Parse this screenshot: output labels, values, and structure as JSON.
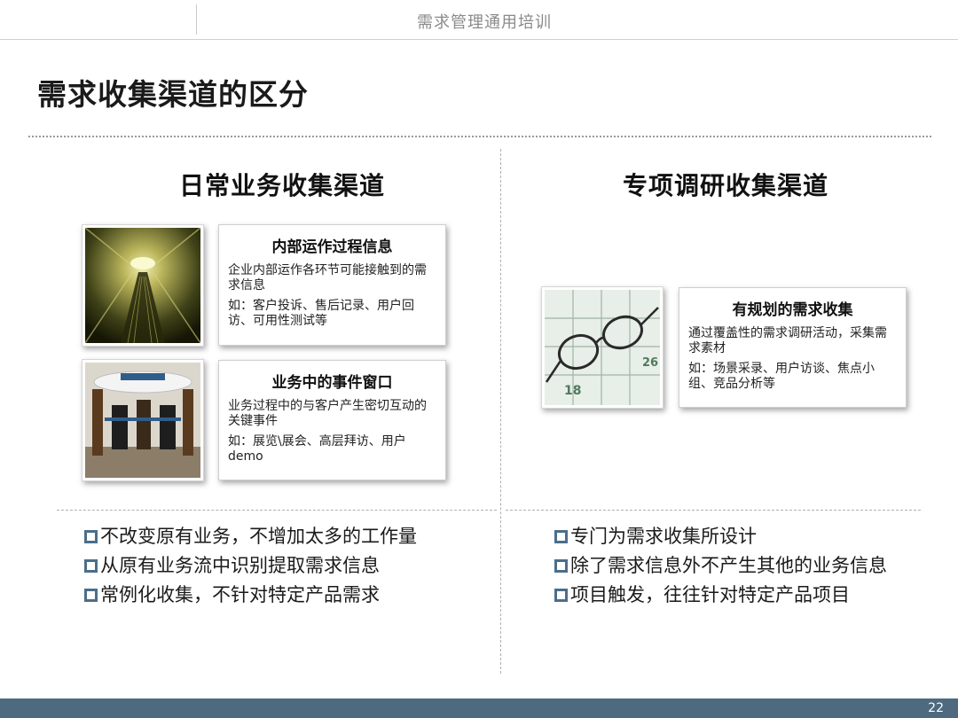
{
  "header": {
    "title": "需求管理通用培训"
  },
  "page": {
    "title": "需求收集渠道的区分",
    "number": "22"
  },
  "left": {
    "title": "日常业务收集渠道",
    "cards": [
      {
        "title": "内部运作过程信息",
        "description": "企业内部运作各环节可能接触到的需求信息",
        "example": "如：客户投诉、售后记录、用户回访、可用性测试等"
      },
      {
        "title": "业务中的事件窗口",
        "description": "业务过程中的与客户产生密切互动的关键事件",
        "example": "如：展览\\展会、高层拜访、用户demo"
      }
    ],
    "bullets": [
      "不改变原有业务，不增加太多的工作量",
      "从原有业务流中识别提取需求信息",
      "常例化收集，不针对特定产品需求"
    ]
  },
  "right": {
    "title": "专项调研收集渠道",
    "cards": [
      {
        "title": "有规划的需求收集",
        "description": "通过覆盖性的需求调研活动，采集需求素材",
        "example": "如：场景采录、用户访谈、焦点小组、竞品分析等"
      }
    ],
    "bullets": [
      "专门为需求收集所设计",
      "除了需求信息外不产生其他的业务信息",
      "项目触发，往往针对特定产品项目"
    ]
  },
  "colors": {
    "bullet": "#4b6e8a",
    "footer": "#4d6a7e"
  }
}
